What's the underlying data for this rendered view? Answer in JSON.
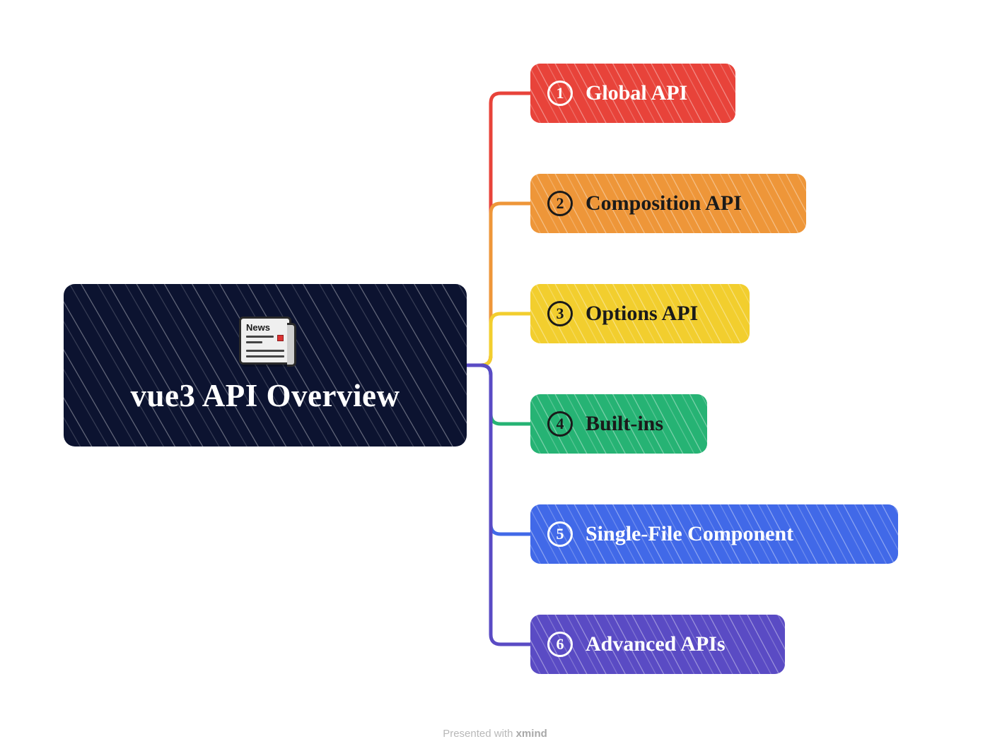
{
  "root": {
    "title": "vue3 API Overview",
    "icon_label": "News"
  },
  "branches": [
    {
      "number": "1",
      "label": "Global API",
      "color": "#e8433a"
    },
    {
      "number": "2",
      "label": "Composition API",
      "color": "#ee9639"
    },
    {
      "number": "3",
      "label": "Options API",
      "color": "#f2ce2e"
    },
    {
      "number": "4",
      "label": "Built-ins",
      "color": "#26b374"
    },
    {
      "number": "5",
      "label": "Single-File Component",
      "color": "#4169e8"
    },
    {
      "number": "6",
      "label": "Advanced APIs",
      "color": "#5a4bc4"
    }
  ],
  "footer": {
    "prefix": "Presented with ",
    "brand": "xmind"
  }
}
